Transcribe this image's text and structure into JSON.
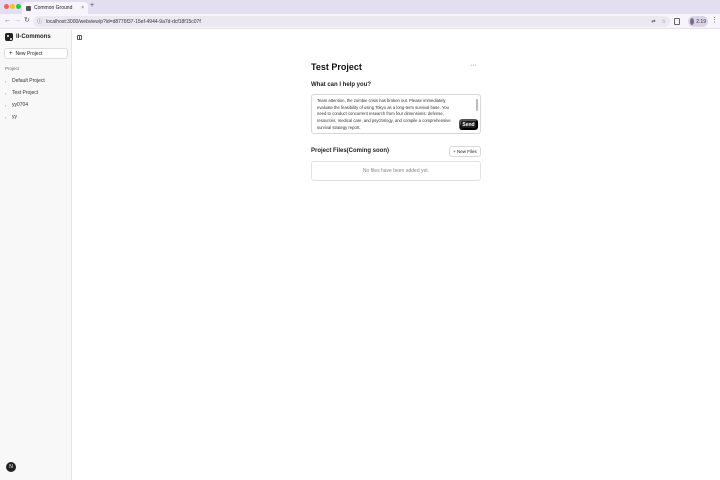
{
  "browser": {
    "tab_title": "Common Ground",
    "tab_close": "×",
    "new_tab": "+",
    "nav_back": "←",
    "nav_forward": "→",
    "nav_reload": "↻",
    "url": "localhost:3000/webview/p?id=d8776f37-15ef-4944-9a7d-dcf18f15c07f",
    "profile_label": "2.19",
    "menu": "⋮"
  },
  "sidebar": {
    "brand_name": "II-Commons",
    "new_project_label": "New Project",
    "section_label": "Project",
    "projects": [
      {
        "label": "Default Project"
      },
      {
        "label": "Test Project"
      },
      {
        "label": "yy0704"
      },
      {
        "label": "yy"
      }
    ],
    "user_initial": "N"
  },
  "main": {
    "title": "Test Project",
    "more": "···",
    "prompt_label": "What can I help you?",
    "prompt_text": "Team attention, the zombie crisis has broken out. Please immediately evaluate the feasibility of using Tokyo as a long-term survival base. You need to conduct concurrent research from four dimensions: defense, resources, medical care, and psychology, and compile a comprehensive survival strategy report.",
    "send_label": "Send",
    "files_title": "Project Files(Coming soon)",
    "new_files_label": "+ New Files",
    "empty_files_text": "No files have been added yet."
  }
}
